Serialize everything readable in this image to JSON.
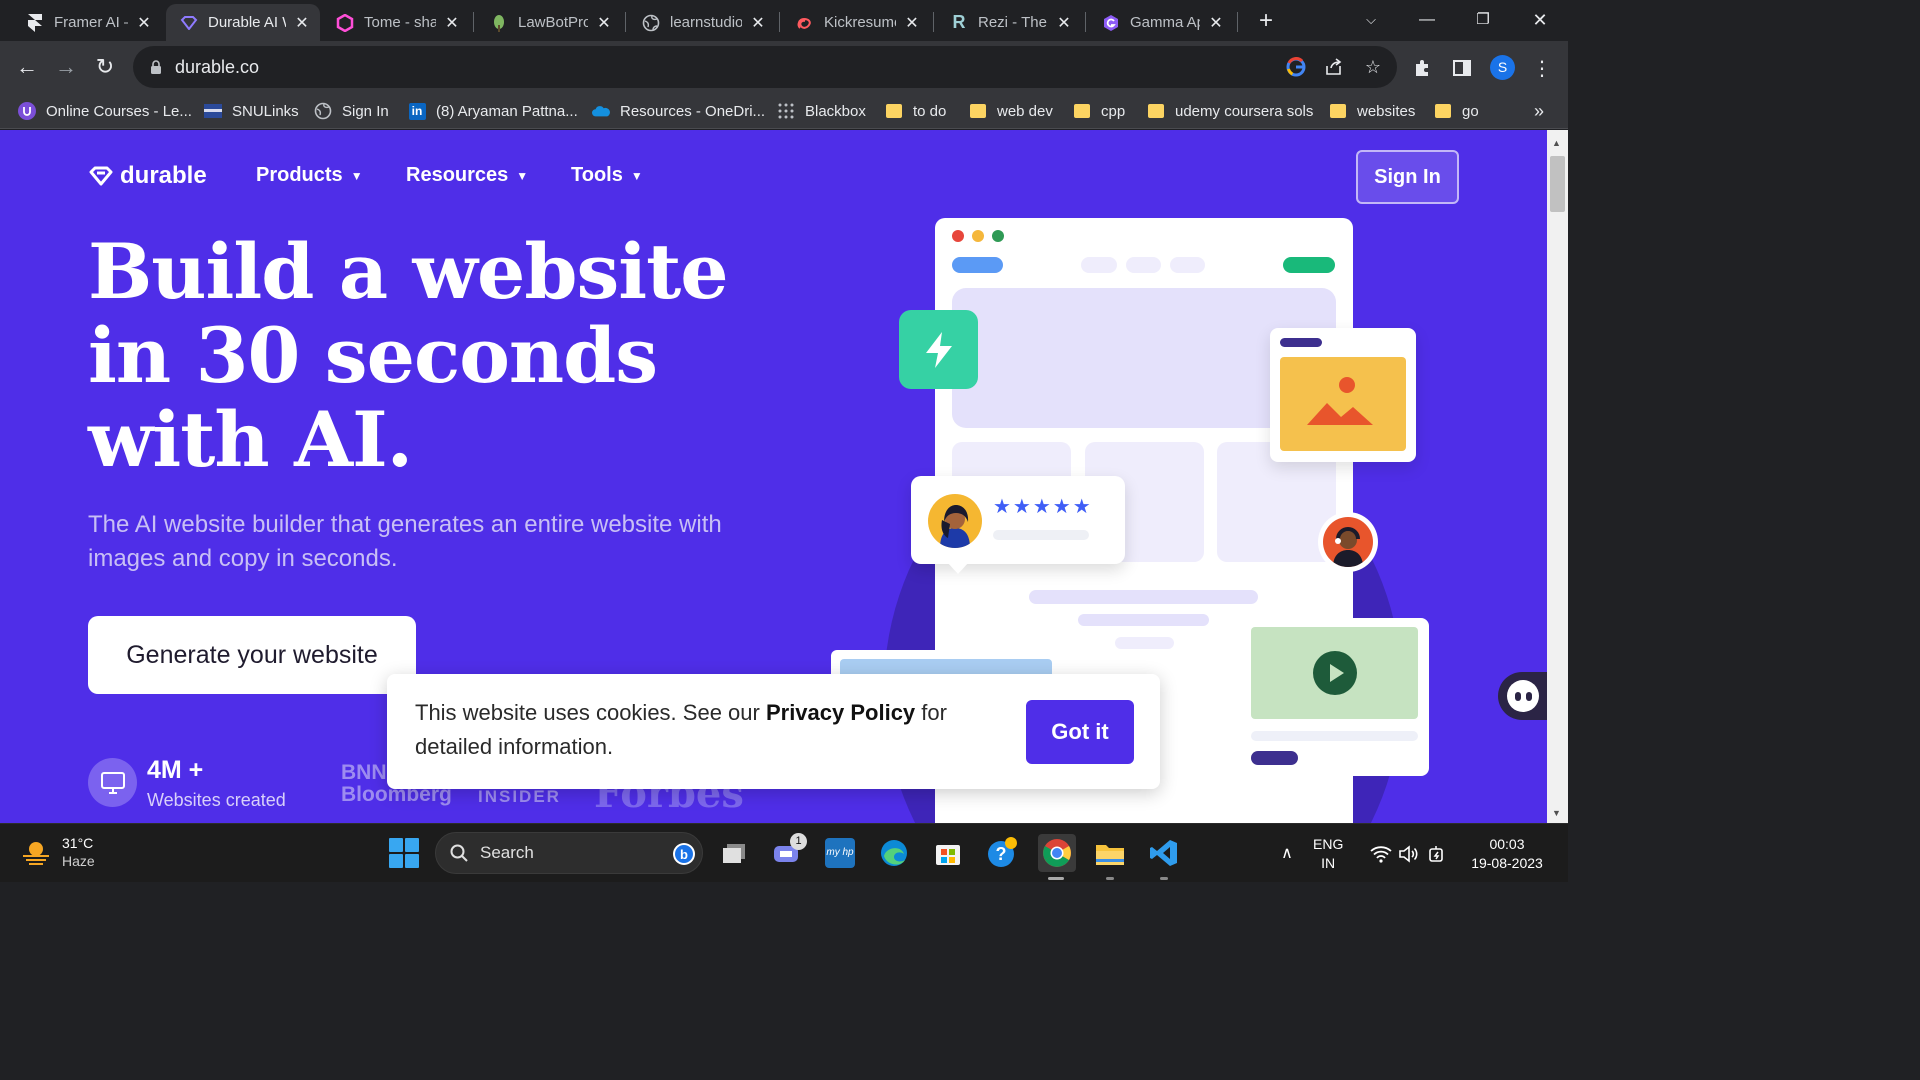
{
  "browser": {
    "tabs": [
      {
        "title": "Framer AI —",
        "active": false
      },
      {
        "title": "Durable AI W",
        "active": true
      },
      {
        "title": "Tome - shap",
        "active": false
      },
      {
        "title": "LawBotPro",
        "active": false
      },
      {
        "title": "learnstudio",
        "active": false
      },
      {
        "title": "Kickresume",
        "active": false
      },
      {
        "title": "Rezi - The L",
        "active": false
      },
      {
        "title": "Gamma Ap",
        "active": false
      }
    ],
    "url": "durable.co",
    "profile_initial": "S",
    "bookmarks": [
      "Online Courses - Le...",
      "SNULinks",
      "Sign In",
      "(8) Aryaman Pattna...",
      "Resources - OneDri...",
      "Blackbox",
      "to do",
      "web dev",
      "cpp",
      "udemy coursera sols",
      "websites",
      "go"
    ],
    "overflow": "»"
  },
  "page": {
    "logo": "durable",
    "nav": [
      "Products",
      "Resources",
      "Tools"
    ],
    "signin": "Sign In",
    "hero_lines": [
      "Build a website",
      "in 30 seconds",
      "with AI."
    ],
    "subtitle": "The AI website builder that generates an entire website with images and copy in seconds.",
    "cta": "Generate your website",
    "stat_number": "4M +",
    "stat_label": "Websites created",
    "press": [
      "BNN Bloomberg",
      "INSIDER",
      "Forbes"
    ],
    "review_stars": "★★★★★",
    "cookie": {
      "prefix": "This website uses cookies. See our ",
      "link": "Privacy Policy",
      "suffix": " for detailed information.",
      "button": "Got it"
    }
  },
  "taskbar": {
    "weather_temp": "31°C",
    "weather_cond": "Haze",
    "search": "Search",
    "teams_badge": "1",
    "lang1": "ENG",
    "lang2": "IN",
    "time": "00:03",
    "date": "19-08-2023"
  },
  "colors": {
    "brand": "#4f2ee8",
    "accent_green": "#36d1a4",
    "chrome_dark": "#202124",
    "chrome_mid": "#35363a"
  }
}
